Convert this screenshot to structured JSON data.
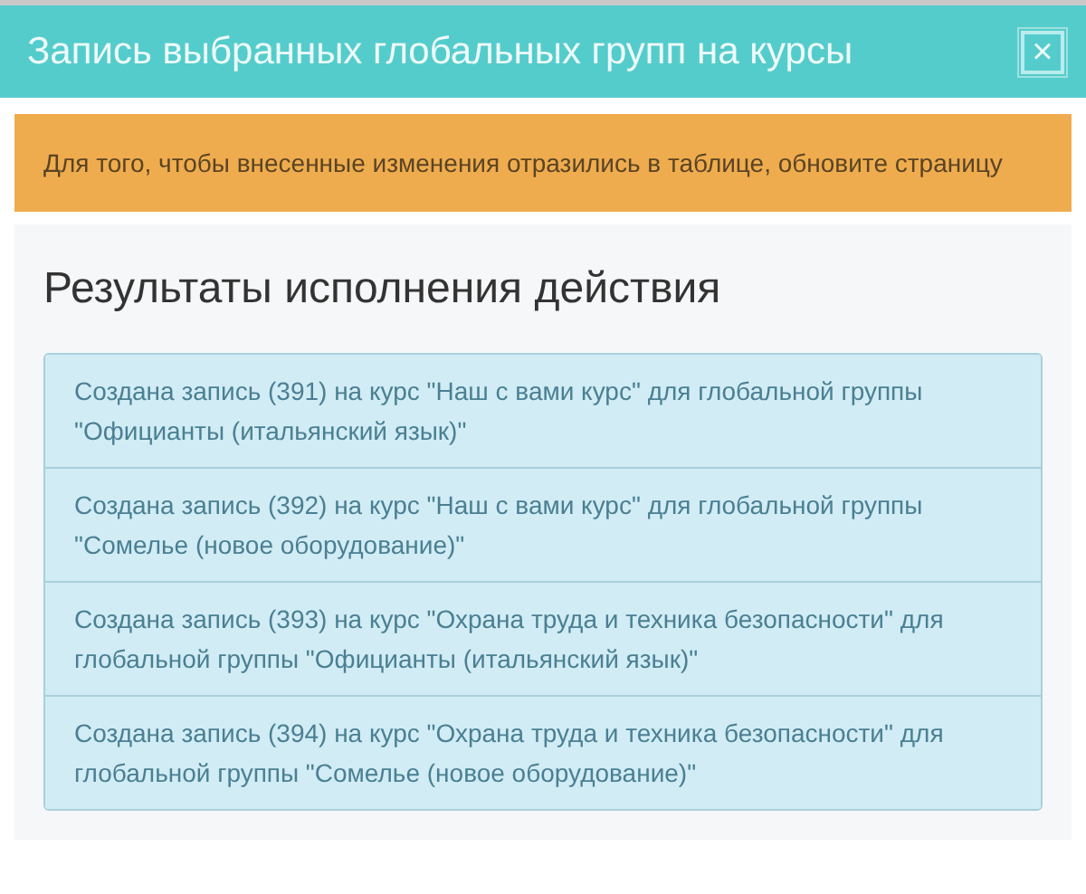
{
  "window": {
    "title": "Запись выбранных глобальных групп на курсы",
    "close_label": "×"
  },
  "alert": {
    "text": "Для того, чтобы внесенные изменения отразились в таблице, обновите страницу"
  },
  "results": {
    "heading": "Результаты исполнения действия",
    "items": [
      {
        "text": "Создана запись (391) на курс \"Наш с вами курс\" для глобальной группы \"Официанты (итальянский язык)\""
      },
      {
        "text": "Создана запись (392) на курс \"Наш с вами курс\" для глобальной группы \"Сомелье (новое оборудование)\""
      },
      {
        "text": "Создана запись (393) на курс \"Охрана труда и техника безопасности\" для глобальной группы \"Официанты (итальянский язык)\""
      },
      {
        "text": "Создана запись (394) на курс \"Охрана труда и техника безопасности\" для глобальной группы \"Сомелье (новое оборудование)\""
      }
    ]
  }
}
